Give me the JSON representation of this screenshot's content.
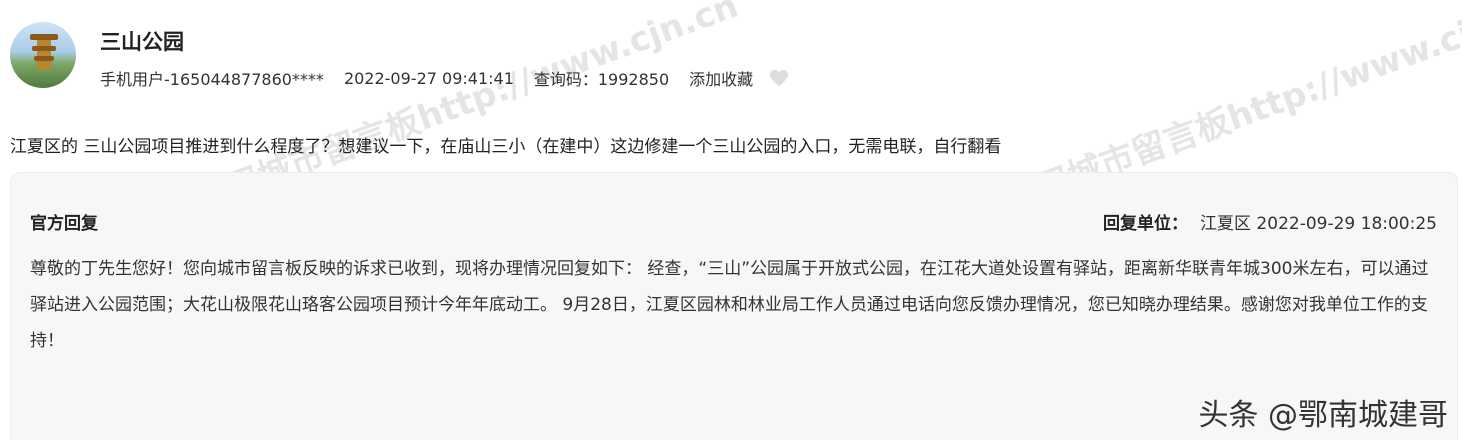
{
  "post": {
    "title": "三山公园",
    "author": "手机用户-165044877860****",
    "datetime": "2022-09-27 09:41:41",
    "query_code": "查询码：1992850",
    "favorite_label": "添加收藏",
    "avatar_icon": "yellow-crane-tower-avatar"
  },
  "question": "江夏区的 三山公园项目推进到什么程度了？想建议一下，在庙山三小（在建中）这边修建一个三山公园的入口，无需电联，自行翻看",
  "reply": {
    "label": "官方回复",
    "unit_label": "回复单位：",
    "unit_value": "江夏区 2022-09-29 18:00:25",
    "body": "尊敬的丁先生您好！您向城市留言板反映的诉求已收到，现将办理情况回复如下： 经查，“三山”公园属于开放式公园，在江花大道处设置有驿站，距离新华联青年城300米左右，可以通过驿站进入公园范围；大花山极限花山珞客公园项目预计今年年底动工。 9月28日，江夏区园林和林业局工作人员通过电话向您反馈办理情况，您已知晓办理结果。感谢您对我单位工作的支持！"
  },
  "watermarks": {
    "text_1": "长江网武汉城市留言板http://www.cjn.cn",
    "text_2": "长江网武汉城市留言板http://www.cjn.cn"
  },
  "footer_brand": "头条 @鄂南城建哥"
}
